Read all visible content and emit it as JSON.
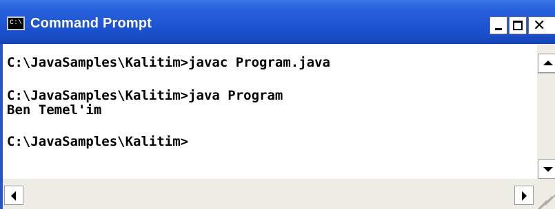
{
  "window": {
    "title": "Command Prompt",
    "app_icon_text": "C:\\",
    "controls": {
      "minimize": "minimize",
      "maximize": "maximize",
      "close": "✕"
    }
  },
  "console": {
    "lines": [
      "C:\\JavaSamples\\Kalitim>javac Program.java",
      "",
      "C:\\JavaSamples\\Kalitim>java Program",
      "Ben Temel'im",
      "",
      "C:\\JavaSamples\\Kalitim>"
    ]
  },
  "colors": {
    "titlebar": "#1e55d3",
    "console_bg": "#ffffff",
    "console_text": "#000000"
  },
  "icons": {
    "app": "cmd-icon",
    "scroll_up": "arrow-up-icon",
    "scroll_down": "arrow-down-icon",
    "scroll_left": "arrow-left-icon",
    "scroll_right": "arrow-right-icon",
    "resize": "resize-grip-icon"
  }
}
